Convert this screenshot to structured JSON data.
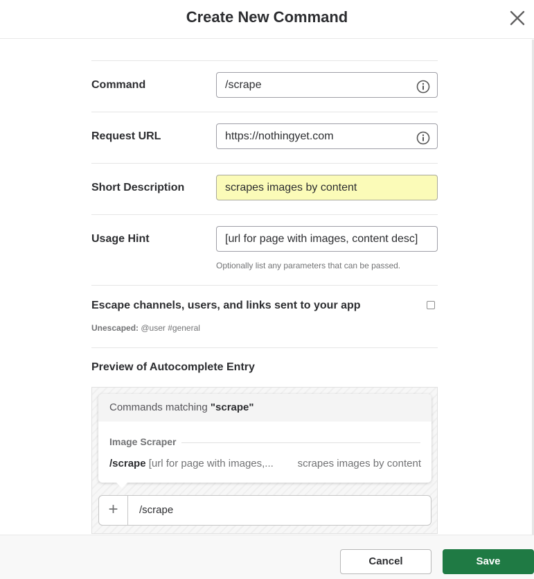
{
  "dialog": {
    "title": "Create New Command"
  },
  "form": {
    "command": {
      "label": "Command",
      "value": "/scrape"
    },
    "request_url": {
      "label": "Request URL",
      "value": "https://nothingyet.com"
    },
    "short_description": {
      "label": "Short Description",
      "value": "scrapes images by content"
    },
    "usage_hint": {
      "label": "Usage Hint",
      "value": "[url for page with images, content desc]",
      "hint": "Optionally list any parameters that can be passed."
    },
    "escape": {
      "label": "Escape channels, users, and links sent to your app",
      "checked": false,
      "unescaped_label": "Unescaped:",
      "unescaped_example": "@user #general"
    }
  },
  "preview": {
    "title": "Preview of Autocomplete Entry",
    "matching_prefix": "Commands matching ",
    "matching_term": "\"scrape\"",
    "app_name": "Image Scraper",
    "item_command": "/scrape",
    "item_hint": "[url for page with images,...",
    "item_description": "scrapes images by content",
    "message_text": "/scrape",
    "plus_symbol": "+"
  },
  "footer": {
    "cancel_label": "Cancel",
    "save_label": "Save"
  },
  "colors": {
    "highlight_field": "#fbfbb8",
    "save_button": "#1f7a44"
  }
}
